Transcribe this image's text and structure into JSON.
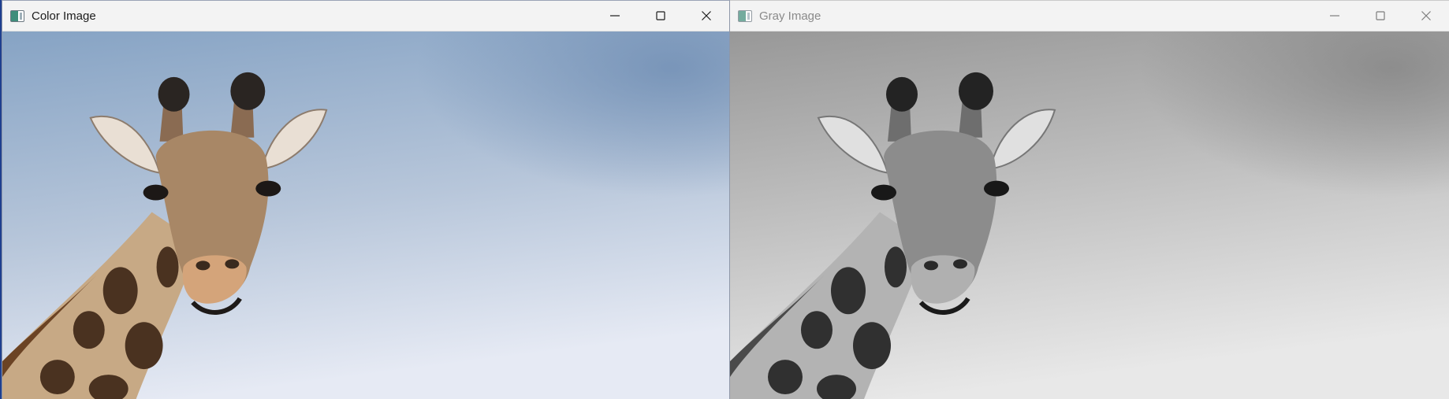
{
  "windows": {
    "color": {
      "title": "Color Image",
      "icon": "opencv-window-icon",
      "controls": [
        "minimize-icon",
        "maximize-icon",
        "close-icon"
      ],
      "image": "giraffe-head-color-photo"
    },
    "gray": {
      "title": "Gray Image",
      "icon": "opencv-window-icon",
      "controls": [
        "minimize-icon",
        "maximize-icon",
        "close-icon"
      ],
      "image": "giraffe-head-grayscale-photo"
    }
  },
  "colors": {
    "sky_top": "#7f9dc0",
    "sky_bottom": "#e8ecf6",
    "gray_top": "#8c8c8c",
    "gray_bottom": "#e6e6e6",
    "desktop": "#1e3f8f"
  }
}
